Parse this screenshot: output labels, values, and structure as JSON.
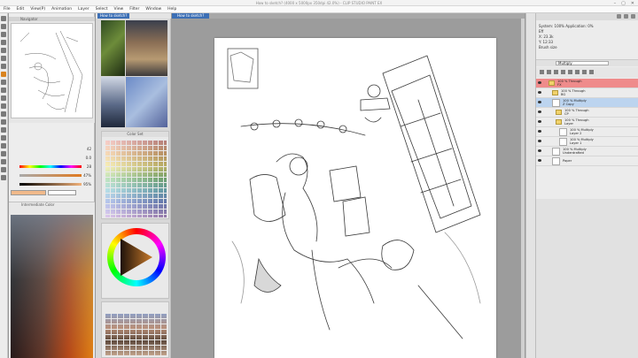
{
  "window": {
    "title": "How to sketch?  (4000 x 5000px 350dpi 42.0%)  - CLIP STUDIO PAINT EX",
    "controls": [
      "–",
      "▢",
      "✕"
    ]
  },
  "menu": [
    "File",
    "Edit",
    "View(P)",
    "Animation",
    "Layer",
    "Select",
    "View",
    "Filter",
    "Window",
    "Help"
  ],
  "navigator": {
    "header": "Navigator"
  },
  "sliders": {
    "zoom_value": "42",
    "rotate_value": "0.0",
    "h_value": "28",
    "s_value": "47%",
    "v_value": "95%"
  },
  "intermediate": {
    "header": "Intermediate Color"
  },
  "reference": {
    "tab_label": "How to sketch?"
  },
  "colorset": {
    "header": "Color Set"
  },
  "layer_property": {
    "opacity_line": "System: 100% Application: 0%",
    "lines": [
      "Eff",
      "X: 23.3k",
      "Y: 12:33",
      "Brush size",
      "0.0 14:1k"
    ]
  },
  "blend": {
    "label": "Multiply",
    "value": "100"
  },
  "layers": [
    {
      "name": "100 % Through",
      "sub": "FX",
      "kind": "folder",
      "style": "red",
      "indent": 0
    },
    {
      "name": "100 % Through",
      "sub": "BG",
      "kind": "folder",
      "style": "normal",
      "indent": 1
    },
    {
      "name": "100 % Multiply",
      "sub": "Z Copy",
      "kind": "layer",
      "style": "sel",
      "indent": 1
    },
    {
      "name": "100 % Through",
      "sub": "CP",
      "kind": "folder",
      "style": "normal",
      "indent": 2
    },
    {
      "name": "100 % Through",
      "sub": "Layer",
      "kind": "folder",
      "style": "normal",
      "indent": 2
    },
    {
      "name": "100 % Multiply",
      "sub": "Layer 2",
      "kind": "layer",
      "style": "normal",
      "indent": 3
    },
    {
      "name": "100 % Multiply",
      "sub": "Layer 1",
      "kind": "layer",
      "style": "normal",
      "indent": 3
    },
    {
      "name": "100 % Multiply",
      "sub": "Underdrafted",
      "kind": "layer",
      "style": "normal",
      "indent": 1
    },
    {
      "name": "",
      "sub": "Paper",
      "kind": "paper",
      "style": "normal",
      "indent": 1
    }
  ],
  "colors": {
    "accent_blue": "#3c6fb5",
    "main_color": "#f0b98a",
    "sub_color": "#ffffff",
    "active_tool": "#d9831f",
    "selected_layer": "#bcd4ef",
    "red_layer": "#ef8b8b"
  }
}
